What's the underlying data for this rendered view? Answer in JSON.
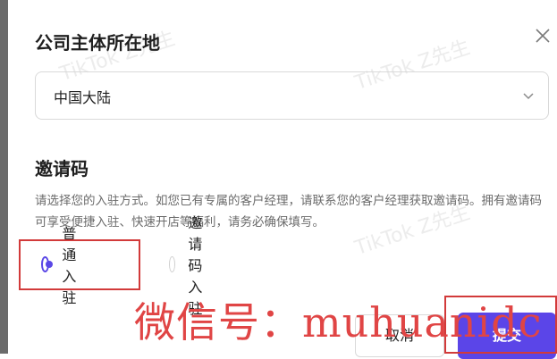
{
  "dialog": {
    "title": "公司主体所在地",
    "close_icon": "close-icon",
    "region_select": {
      "value": "中国大陆",
      "icon": "chevron-down-icon"
    },
    "invite_section": {
      "title": "邀请码",
      "description": "请选择您的入驻方式。如您已有专属的客户经理，请联系您的客户经理获取邀请码。拥有邀请码可享受便捷入驻、快速开店等福利，请务必确保填写。"
    },
    "entry_options": [
      {
        "label": "普通入驻",
        "selected": true
      },
      {
        "label": "邀请码入驻",
        "selected": false
      }
    ],
    "buttons": {
      "cancel": "取消",
      "submit": "提交"
    }
  },
  "watermark_text": "TikTok Z先生",
  "overlay_text": "微信号：muhuanidc",
  "colors": {
    "accent": "#5b45e8",
    "highlight_box": "#d23a3a",
    "overlay_text": "#e04545"
  }
}
